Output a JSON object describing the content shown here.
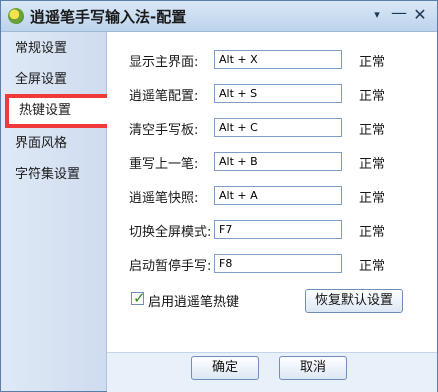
{
  "window": {
    "title": "逍遥笔手写输入法-配置",
    "menu_glyph": "▾",
    "minimize_glyph": "—",
    "close_glyph": "✕"
  },
  "sidebar": {
    "items": [
      {
        "label": "常规设置"
      },
      {
        "label": "全屏设置"
      },
      {
        "label": "热键设置"
      },
      {
        "label": "界面风格"
      },
      {
        "label": "字符集设置"
      }
    ],
    "active_index": 2
  },
  "hotkeys": [
    {
      "label": "显示主界面:",
      "value": "Alt + X",
      "status": "正常"
    },
    {
      "label": "逍遥笔配置:",
      "value": "Alt + S",
      "status": "正常"
    },
    {
      "label": "清空手写板:",
      "value": "Alt + C",
      "status": "正常"
    },
    {
      "label": "重写上一笔:",
      "value": "Alt + B",
      "status": "正常"
    },
    {
      "label": "逍遥笔快照:",
      "value": "Alt + A",
      "status": "正常"
    },
    {
      "label": "切换全屏模式:",
      "value": "F7",
      "status": "正常"
    },
    {
      "label": "启动暂停手写:",
      "value": "F8",
      "status": "正常"
    }
  ],
  "enable_hotkeys": {
    "label": "启用逍遥笔热键",
    "checked": true
  },
  "buttons": {
    "restore_default": "恢复默认设置",
    "ok": "确定",
    "cancel": "取消"
  },
  "colors": {
    "highlight_border": "#f03a3a",
    "check_color": "#2a8a2a"
  }
}
